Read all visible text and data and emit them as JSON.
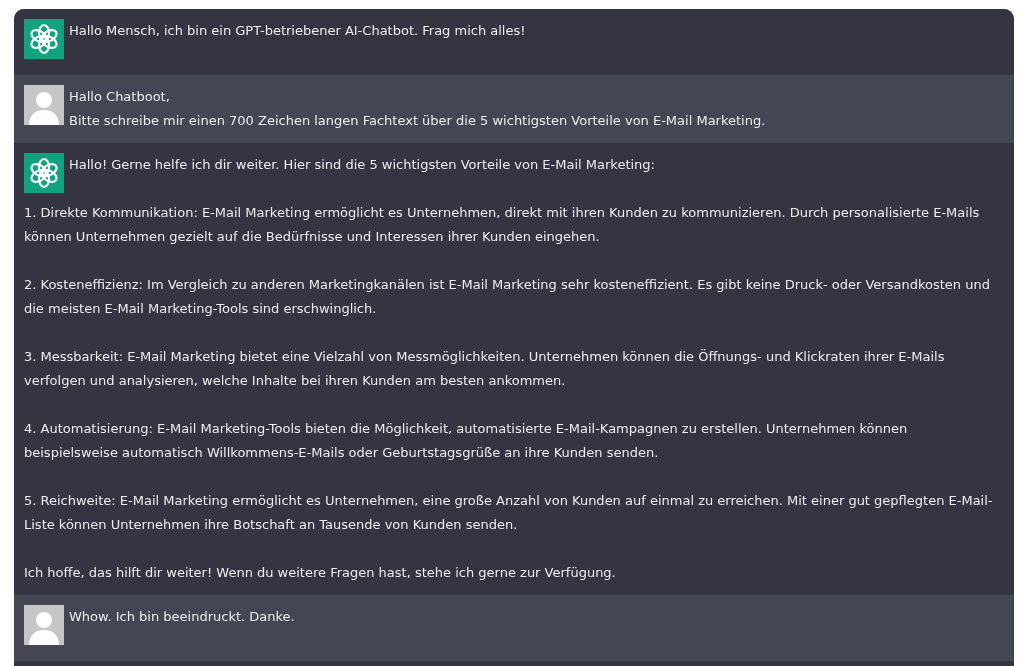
{
  "messages": [
    {
      "kind": "bot",
      "lines": [
        "Hallo Mensch, ich bin ein GPT-betriebener AI-Chatbot. Frag mich alles!"
      ]
    },
    {
      "kind": "user",
      "lines": [
        "Hallo Chatboot,",
        "Bitte schreibe mir einen 700 Zeichen langen Fachtext über die 5 wichtigsten Vorteile von E-Mail Marketing."
      ]
    },
    {
      "kind": "bot",
      "lines": [
        "Hallo! Gerne helfe ich dir weiter. Hier sind die 5 wichtigsten Vorteile von E-Mail Marketing:"
      ],
      "body": [
        "1. Direkte Kommunikation: E-Mail Marketing ermöglicht es Unternehmen, direkt mit ihren Kunden zu kommunizieren. Durch personalisierte E-Mails können Unternehmen gezielt auf die Bedürfnisse und Interessen ihrer Kunden eingehen.",
        "2. Kosteneffizienz: Im Vergleich zu anderen Marketingkanälen ist E-Mail Marketing sehr kosteneffizient. Es gibt keine Druck- oder Versandkosten und die meisten E-Mail Marketing-Tools sind erschwinglich.",
        "3. Messbarkeit: E-Mail Marketing bietet eine Vielzahl von Messmöglichkeiten. Unternehmen können die Öffnungs- und Klickraten ihrer E-Mails verfolgen und analysieren, welche Inhalte bei ihren Kunden am besten ankommen.",
        "4. Automatisierung: E-Mail Marketing-Tools bieten die Möglichkeit, automatisierte E-Mail-Kampagnen zu erstellen. Unternehmen können beispielsweise automatisch Willkommens-E-Mails oder Geburtstagsgrüße an ihre Kunden senden.",
        "5. Reichweite: E-Mail Marketing ermöglicht es Unternehmen, eine große Anzahl von Kunden auf einmal zu erreichen. Mit einer gut gepflegten E-Mail-Liste können Unternehmen ihre Botschaft an Tausende von Kunden senden.",
        "Ich hoffe, das hilft dir weiter! Wenn du weitere Fragen hast, stehe ich gerne zur Verfügung."
      ]
    },
    {
      "kind": "user",
      "lines": [
        "Whow. Ich bin beeindruckt. Danke."
      ]
    }
  ]
}
